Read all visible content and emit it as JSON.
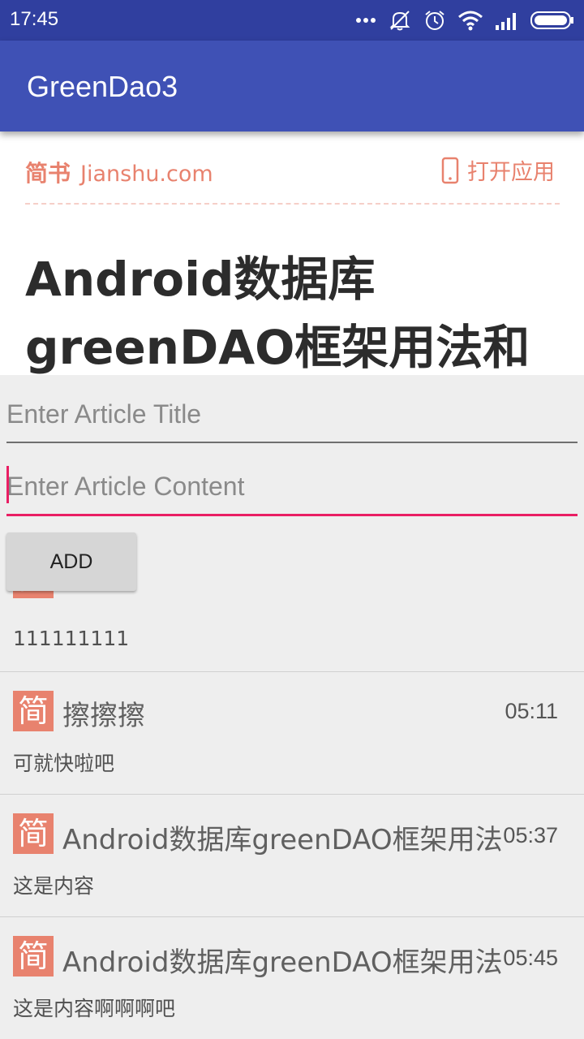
{
  "status_bar": {
    "time": "17:45",
    "icons": [
      "more-dots-icon",
      "mute-icon",
      "alarm-icon",
      "wifi-icon",
      "signal-icon",
      "battery-icon"
    ]
  },
  "app_bar": {
    "title": "GreenDao3"
  },
  "webview": {
    "brand_cn": "简书",
    "brand_en": "Jianshu.com",
    "open_app": "打开应用",
    "article_title_line1": "Android数据库",
    "article_title_line2": "greenDAO框架用法和"
  },
  "form": {
    "title_placeholder": "Enter Article Title",
    "content_placeholder": "Enter Article Content",
    "add_label": "ADD"
  },
  "articles": [
    {
      "icon": "简",
      "title": "",
      "time": "",
      "content": "111111111"
    },
    {
      "icon": "简",
      "title": "擦擦擦",
      "time": "05:11",
      "content": "可就快啦吧"
    },
    {
      "icon": "简",
      "title": "Android数据库greenDAO框架用法",
      "time": "05:37",
      "content": "这是内容"
    },
    {
      "icon": "简",
      "title": "Android数据库greenDAO框架用法",
      "time": "05:45",
      "content": "这是内容啊啊啊吧"
    }
  ],
  "colors": {
    "status_bar": "#303f9f",
    "app_bar": "#3f51b5",
    "accent": "#e91e63",
    "jianshu": "#e8826e"
  }
}
